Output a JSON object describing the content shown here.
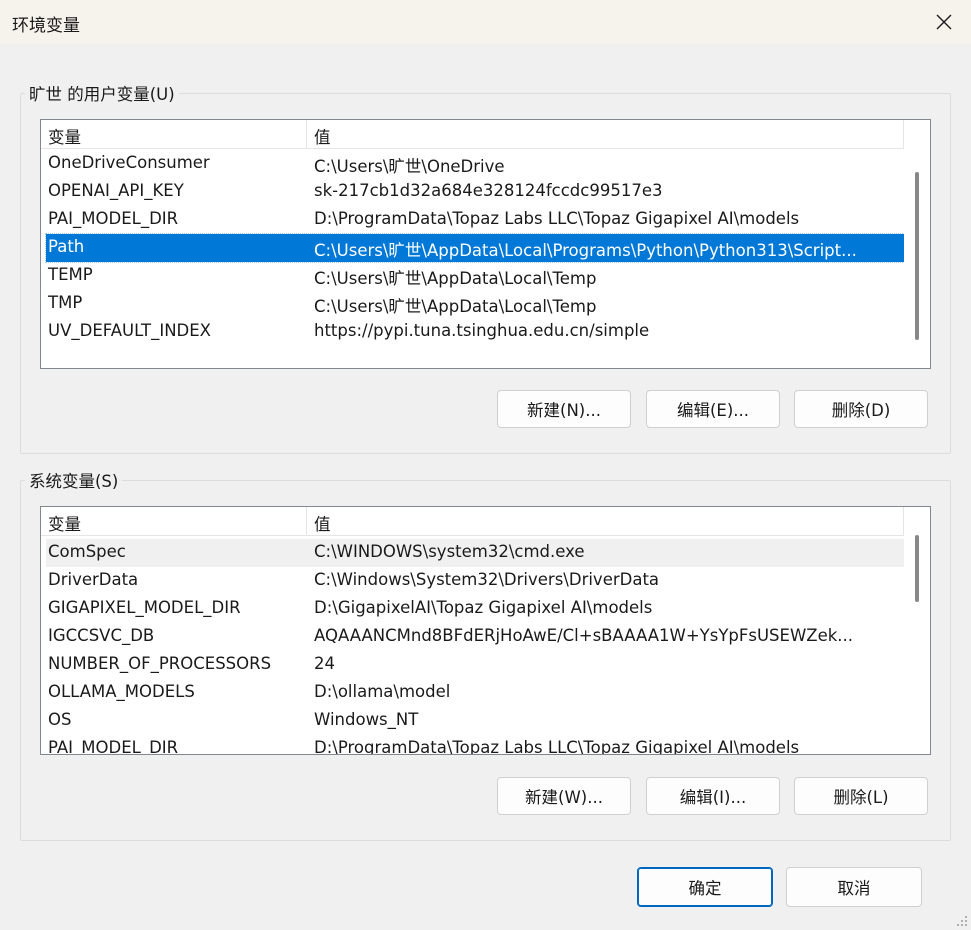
{
  "window": {
    "title": "环境变量",
    "close_icon": "close-icon"
  },
  "user_vars": {
    "legend": "旷世 的用户变量(U)",
    "col_name": "变量",
    "col_value": "值",
    "rows": [
      {
        "name": "OneDriveConsumer",
        "value": "C:\\Users\\旷世\\OneDrive"
      },
      {
        "name": "OPENAI_API_KEY",
        "value": "sk-217cb1d32a684e328124fccdc99517e3"
      },
      {
        "name": "PAI_MODEL_DIR",
        "value": "D:\\ProgramData\\Topaz Labs LLC\\Topaz Gigapixel AI\\models"
      },
      {
        "name": "Path",
        "value": "C:\\Users\\旷世\\AppData\\Local\\Programs\\Python\\Python313\\Script..."
      },
      {
        "name": "TEMP",
        "value": "C:\\Users\\旷世\\AppData\\Local\\Temp"
      },
      {
        "name": "TMP",
        "value": "C:\\Users\\旷世\\AppData\\Local\\Temp"
      },
      {
        "name": "UV_DEFAULT_INDEX",
        "value": "https://pypi.tuna.tsinghua.edu.cn/simple"
      }
    ],
    "selected": "Path",
    "buttons": {
      "new": "新建(N)...",
      "edit": "编辑(E)...",
      "delete": "删除(D)"
    }
  },
  "system_vars": {
    "legend": "系统变量(S)",
    "col_name": "变量",
    "col_value": "值",
    "rows": [
      {
        "name": "ComSpec",
        "value": "C:\\WINDOWS\\system32\\cmd.exe"
      },
      {
        "name": "DriverData",
        "value": "C:\\Windows\\System32\\Drivers\\DriverData"
      },
      {
        "name": "GIGAPIXEL_MODEL_DIR",
        "value": "D:\\GigapixelAI\\Topaz Gigapixel AI\\models"
      },
      {
        "name": "IGCCSVC_DB",
        "value": "AQAAANCMnd8BFdERjHoAwE/Cl+sBAAAA1W+YsYpFsUSEWZek..."
      },
      {
        "name": "NUMBER_OF_PROCESSORS",
        "value": "24"
      },
      {
        "name": "OLLAMA_MODELS",
        "value": "D:\\ollama\\model"
      },
      {
        "name": "OS",
        "value": "Windows_NT"
      },
      {
        "name": "PAI_MODEL_DIR",
        "value": "D:\\ProgramData\\Topaz Labs LLC\\Topaz Gigapixel AI\\models"
      }
    ],
    "hovered": "ComSpec",
    "buttons": {
      "new": "新建(W)...",
      "edit": "编辑(I)...",
      "delete": "删除(L)"
    }
  },
  "footer": {
    "ok": "确定",
    "cancel": "取消"
  },
  "colors": {
    "selection": "#0078d7",
    "titlebar": "#f6f3ed",
    "background": "#f0f0f0",
    "primary_border": "#0067c0"
  }
}
